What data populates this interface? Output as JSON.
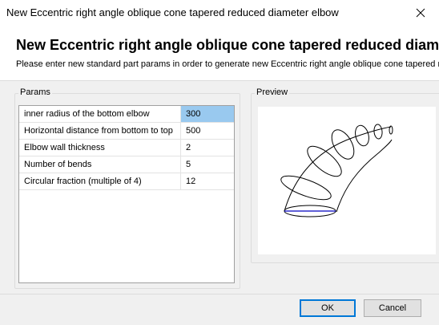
{
  "window": {
    "title": "New Eccentric right angle oblique cone tapered reduced diameter elbow",
    "close_icon": "close-icon"
  },
  "header": {
    "title": "New Eccentric right angle oblique cone tapered reduced diameter elbow",
    "subtitle": "Please enter new standard part params in order to generate new Eccentric right angle oblique cone tapered reduced diameter elbow"
  },
  "params": {
    "group_label": "Params",
    "rows": [
      {
        "name": "inner radius of the bottom elbow",
        "value": "300",
        "selected": true
      },
      {
        "name": "Horizontal distance from bottom to top",
        "value": "500",
        "selected": false
      },
      {
        "name": "Elbow wall thickness",
        "value": "2",
        "selected": false
      },
      {
        "name": "Number of bends",
        "value": "5",
        "selected": false
      },
      {
        "name": "Circular fraction (multiple of 4)",
        "value": "12",
        "selected": false
      }
    ]
  },
  "preview": {
    "group_label": "Preview",
    "image": "tapered-elbow-wireframe-drawing",
    "line_color": "#000000",
    "base_ellipse_color": "#0000c0"
  },
  "buttons": {
    "ok_label": "OK",
    "cancel_label": "Cancel"
  },
  "colors": {
    "selection": "#99c9ef",
    "default_button_border": "#0078d7"
  }
}
